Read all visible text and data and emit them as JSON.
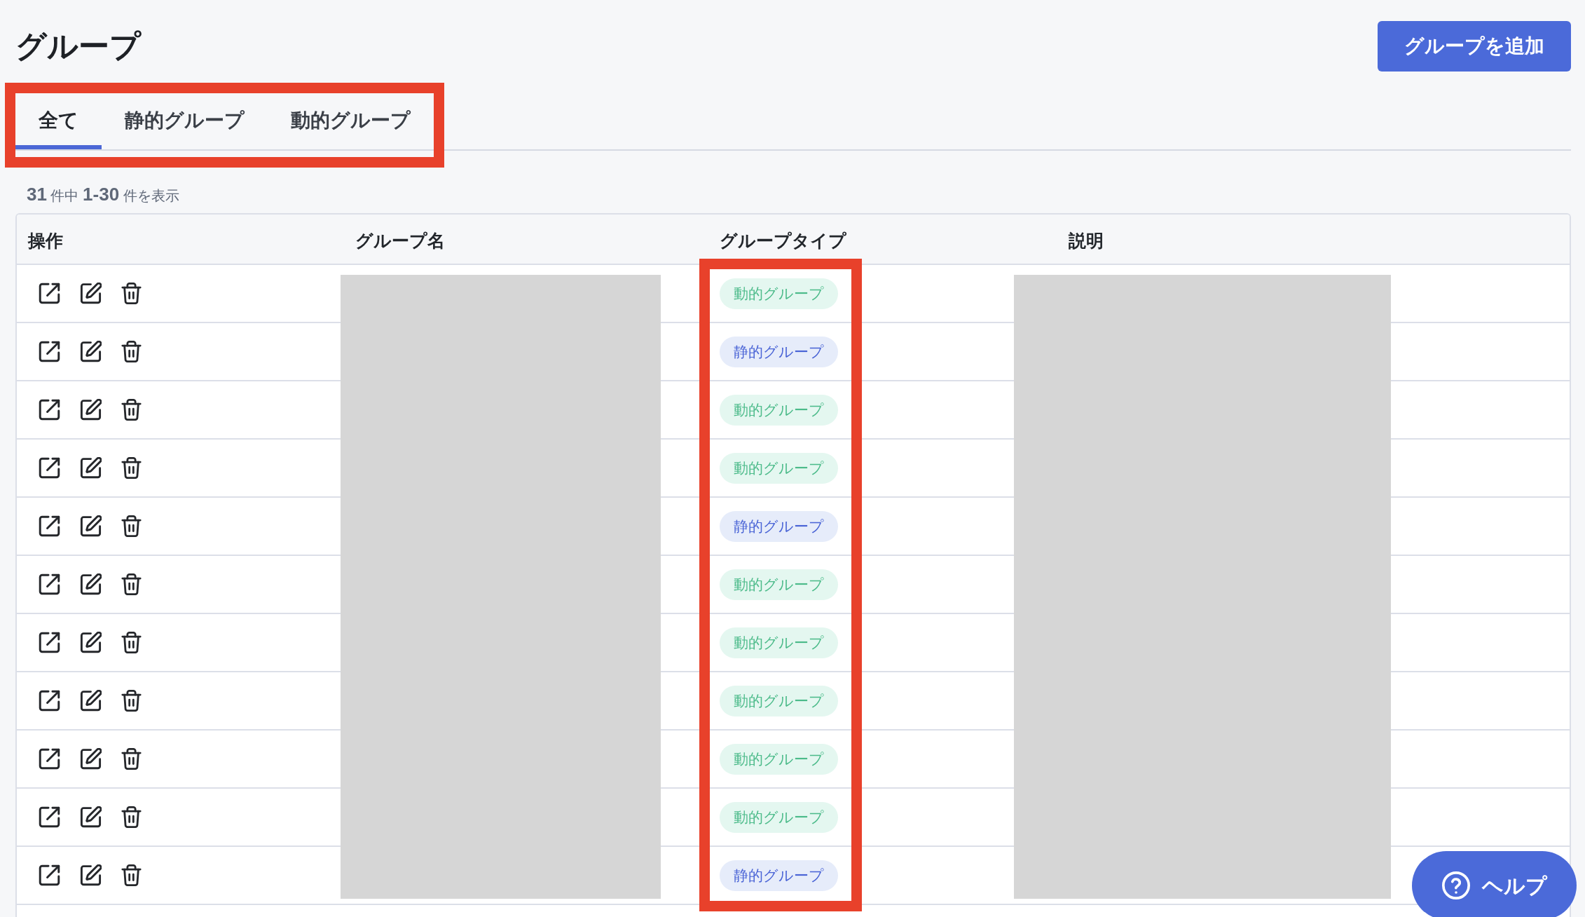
{
  "page": {
    "title": "グループ"
  },
  "add_button": {
    "label": "グループを追加"
  },
  "tabs": {
    "highlighted": true,
    "items": [
      {
        "label": "全て",
        "selected": true
      },
      {
        "label": "静的グループ",
        "selected": false
      },
      {
        "label": "動的グループ",
        "selected": false
      }
    ]
  },
  "result_count": "**31** 件中 **1-30** 件を表示",
  "table": {
    "columns": [
      {
        "label": "操作",
        "redacted": false,
        "highlighted": false
      },
      {
        "label": "グループ名",
        "redacted": true,
        "highlighted": false
      },
      {
        "label": "グループタイプ",
        "redacted": false,
        "highlighted": true
      },
      {
        "label": "説明",
        "redacted": true,
        "highlighted": false
      }
    ],
    "rows": [
      {
        "group_type": {
          "label": "動的グループ",
          "kind": "dynamic"
        }
      },
      {
        "group_type": {
          "label": "静的グループ",
          "kind": "static"
        }
      },
      {
        "group_type": {
          "label": "動的グループ",
          "kind": "dynamic"
        }
      },
      {
        "group_type": {
          "label": "動的グループ",
          "kind": "dynamic"
        }
      },
      {
        "group_type": {
          "label": "静的グループ",
          "kind": "static"
        }
      },
      {
        "group_type": {
          "label": "動的グループ",
          "kind": "dynamic"
        }
      },
      {
        "group_type": {
          "label": "動的グループ",
          "kind": "dynamic"
        }
      },
      {
        "group_type": {
          "label": "動的グループ",
          "kind": "dynamic"
        }
      },
      {
        "group_type": {
          "label": "動的グループ",
          "kind": "dynamic"
        }
      },
      {
        "group_type": {
          "label": "動的グループ",
          "kind": "dynamic"
        }
      },
      {
        "group_type": {
          "label": "静的グループ",
          "kind": "static"
        }
      }
    ]
  },
  "help_button": {
    "label": "ヘルプ"
  }
}
